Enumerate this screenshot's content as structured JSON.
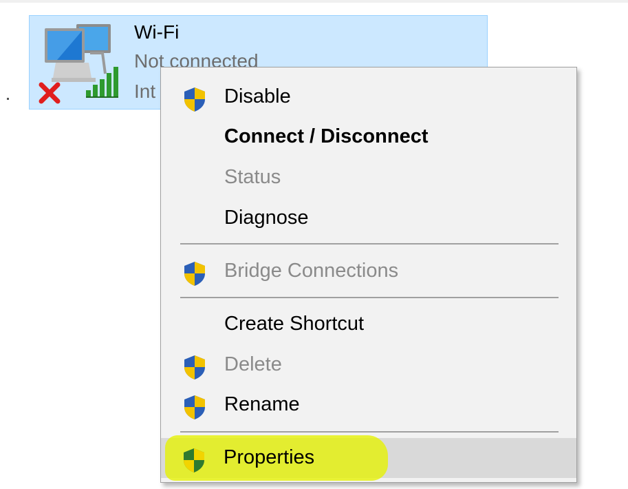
{
  "adapter": {
    "name": "Wi-Fi",
    "status": "Not connected",
    "device": "Int",
    "icon": "network-adapter-icon",
    "error_icon": "red-x-icon",
    "signal_icon": "signal-bars-icon"
  },
  "context_menu": {
    "items": [
      {
        "label": "Disable",
        "icon": "uac-shield-icon",
        "state": "enabled"
      },
      {
        "label": "Connect / Disconnect",
        "icon": null,
        "state": "default"
      },
      {
        "label": "Status",
        "icon": null,
        "state": "disabled"
      },
      {
        "label": "Diagnose",
        "icon": null,
        "state": "enabled"
      },
      {
        "label": "Bridge Connections",
        "icon": "uac-shield-icon",
        "state": "disabled"
      },
      {
        "label": "Create Shortcut",
        "icon": null,
        "state": "enabled"
      },
      {
        "label": "Delete",
        "icon": "uac-shield-icon",
        "state": "disabled"
      },
      {
        "label": "Rename",
        "icon": "uac-shield-icon",
        "state": "enabled"
      },
      {
        "label": "Properties",
        "icon": "uac-shield-icon",
        "state": "hovered"
      }
    ]
  },
  "colors": {
    "selection_bg": "#cce8ff",
    "menu_bg": "#f2f2f2",
    "hover_bg": "#d9d9d9",
    "highlighter": "#e6f200",
    "disabled_text": "#8a8a8a"
  }
}
